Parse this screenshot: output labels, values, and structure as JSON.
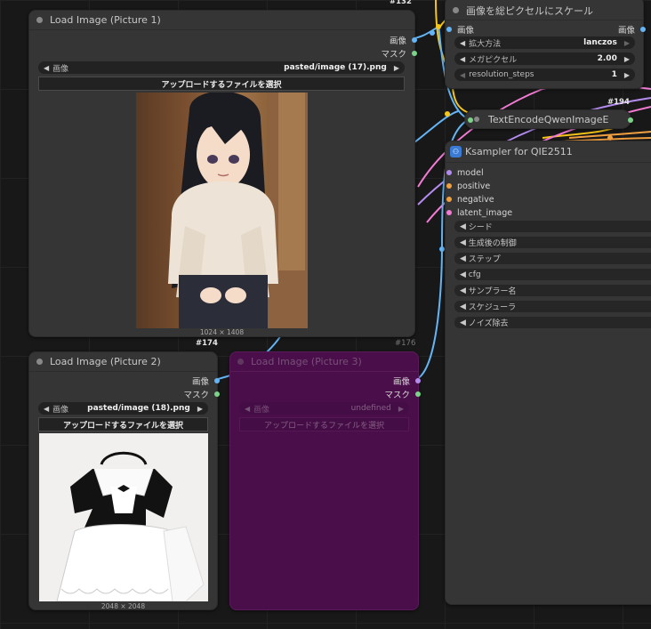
{
  "nodes": {
    "load1": {
      "title": "Load Image (Picture 1)",
      "outputs": [
        "画像",
        "マスク"
      ],
      "widget_label": "画像",
      "widget_value": "pasted/image (17).png",
      "upload_label": "アップロードするファイルを選択",
      "dims": "1024 × 1408",
      "id_label": "#174"
    },
    "load2": {
      "title": "Load Image (Picture 2)",
      "outputs": [
        "画像",
        "マスク"
      ],
      "widget_label": "画像",
      "widget_value": "pasted/image (18).png",
      "upload_label": "アップロードするファイルを選択",
      "dims": "2048 × 2048"
    },
    "load3": {
      "title": "Load Image (Picture 3)",
      "outputs": [
        "画像",
        "マスク"
      ],
      "widget_label": "画像",
      "widget_value": "undefined",
      "upload_label": "アップロードするファイルを選択",
      "id_label": "#176"
    },
    "scale": {
      "title": "画像を総ピクセルにスケール",
      "id_label": "#132",
      "input": "画像",
      "output": "画像",
      "widgets": [
        {
          "label": "拡大方法",
          "value": "lanczos"
        },
        {
          "label": "メガピクセル",
          "value": "2.00"
        },
        {
          "label": "resolution_steps",
          "value": "1"
        }
      ]
    },
    "encode": {
      "title": "TextEncodeQwenImageE",
      "id_label": "#194"
    },
    "ksampler": {
      "title": "Ksampler for QIE2511",
      "inputs": [
        "model",
        "positive",
        "negative",
        "latent_image"
      ],
      "widgets": [
        "シード",
        "生成後の制御",
        "ステップ",
        "cfg",
        "サンプラー名",
        "スケジューラ",
        "ノイズ除去"
      ]
    }
  },
  "colors": {
    "canvas": "#181818",
    "node": "#353535",
    "purple_node": "#4a0f4a",
    "wire_blue": "#64b5f6",
    "wire_yellow": "#f5c518",
    "wire_pink": "#f27bd4",
    "wire_purple": "#b48cf0",
    "wire_orange": "#f0a040"
  }
}
